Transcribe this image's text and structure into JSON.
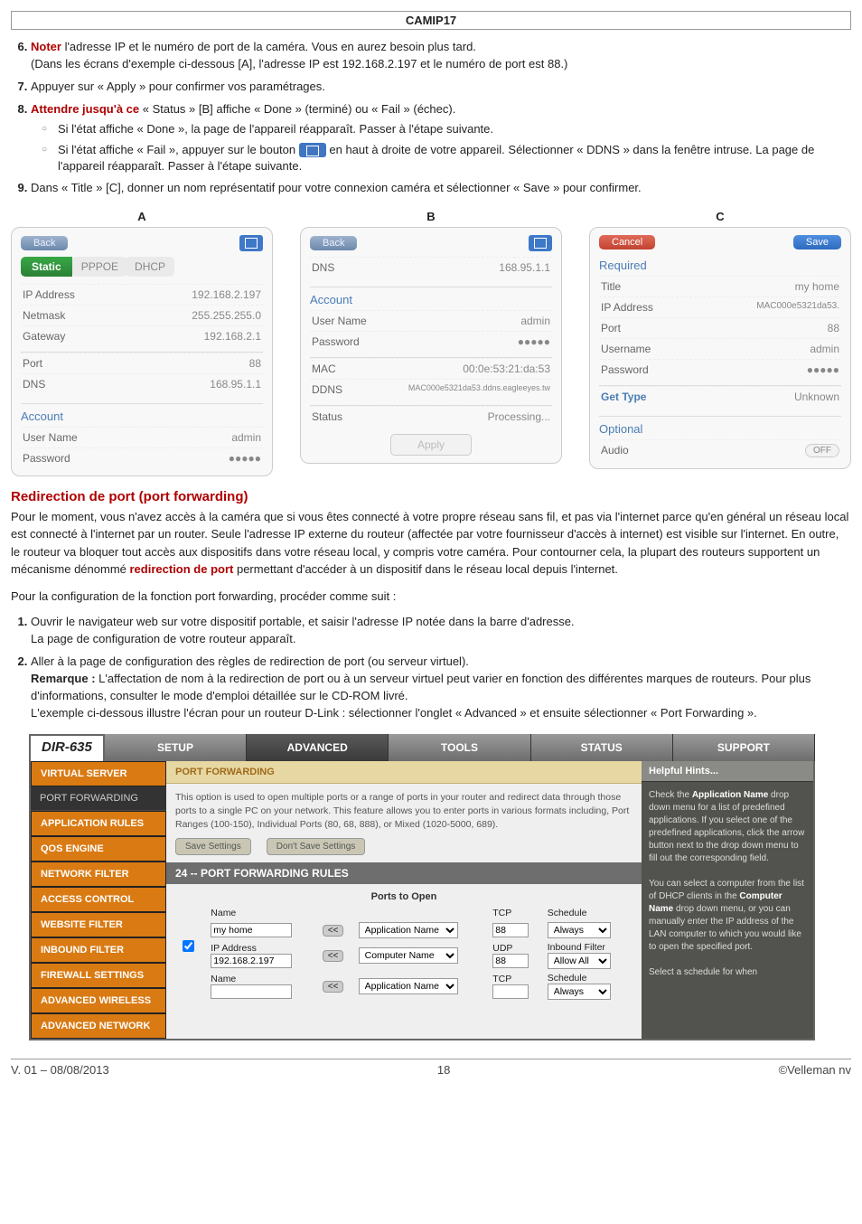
{
  "page_header": "CAMIP17",
  "step6": {
    "num": "6.",
    "lead": "Noter",
    "rest": " l'adresse IP et le numéro de port de la caméra. Vous en aurez besoin plus tard.",
    "sub": "(Dans les écrans d'exemple ci-dessous [A], l'adresse IP est 192.168.2.197 et le numéro de port est 88.)"
  },
  "step7": {
    "num": "7.",
    "text": "Appuyer sur « Apply » pour confirmer vos paramétrages."
  },
  "step8": {
    "num": "8.",
    "lead": "Attendre jusqu'à ce",
    "rest": " « Status » [B] affiche « Done » (terminé) ou « Fail » (échec).",
    "b1": "Si l'état affiche « Done », la page de l'appareil réapparaît. Passer à l'étape suivante.",
    "b2a": "Si l'état affiche « Fail », appuyer sur le bouton ",
    "b2b": " en haut à droite de votre appareil. Sélectionner « DDNS » dans la fenêtre intruse. La page de l'appareil réapparaît. Passer à l'étape suivante."
  },
  "step9": {
    "num": "9.",
    "text": "Dans « Title » [C], donner un nom représentatif pour votre connexion caméra et sélectionner « Save » pour confirmer."
  },
  "panelA": {
    "label": "A",
    "back": "Back",
    "static": "Static",
    "pppoe": "PPPOE",
    "dhcp": "DHCP",
    "ip_lbl": "IP Address",
    "ip_val": "192.168.2.197",
    "nm_lbl": "Netmask",
    "nm_val": "255.255.255.0",
    "gw_lbl": "Gateway",
    "gw_val": "192.168.2.1",
    "port_lbl": "Port",
    "port_val": "88",
    "dns_lbl": "DNS",
    "dns_val": "168.95.1.1",
    "account": "Account",
    "user_lbl": "User Name",
    "user_val": "admin",
    "pwd_lbl": "Password",
    "pwd_val": "●●●●●"
  },
  "panelB": {
    "label": "B",
    "back": "Back",
    "dns_lbl": "DNS",
    "dns_val": "168.95.1.1",
    "account": "Account",
    "user_lbl": "User Name",
    "user_val": "admin",
    "pwd_lbl": "Password",
    "pwd_val": "●●●●●",
    "mac_lbl": "MAC",
    "mac_val": "00:0e:53:21:da:53",
    "ddns_lbl": "DDNS",
    "ddns_val": "MAC000e5321da53.ddns.eagleeyes.tw",
    "status_lbl": "Status",
    "status_val": "Processing...",
    "apply": "Apply"
  },
  "panelC": {
    "label": "C",
    "cancel": "Cancel",
    "save": "Save",
    "required": "Required",
    "title_lbl": "Title",
    "title_val": "my home",
    "ip_lbl": "IP Address",
    "ip_val": "MAC000e5321da53.",
    "port_lbl": "Port",
    "port_val": "88",
    "user_lbl": "Username",
    "user_val": "admin",
    "pwd_lbl": "Password",
    "pwd_val": "●●●●●",
    "get_lbl": "Get Type",
    "get_val": "Unknown",
    "optional": "Optional",
    "audio_lbl": "Audio",
    "audio_val": "OFF"
  },
  "pf_title": "Redirection de port (port forwarding)",
  "pf_para1a": "Pour le moment, vous n'avez accès à la caméra que si vous êtes connecté à votre propre réseau sans fil, et pas via l'internet parce qu'en général un réseau local est connecté à l'internet par un router. Seule l'adresse IP externe du routeur (affectée par votre fournisseur d'accès à internet) est visible sur l'internet. En outre, le routeur va bloquer tout accès aux dispositifs dans votre réseau local, y compris votre caméra. Pour contourner cela, la plupart des routeurs supportent un mécanisme dénommé ",
  "pf_bold": "redirection de port",
  "pf_para1b": " permettant d'accéder à un dispositif dans le réseau local depuis l'internet.",
  "pf_para2": "Pour la configuration de la fonction port forwarding, procéder comme suit :",
  "pf_s1": {
    "num": "1.",
    "a": "Ouvrir le navigateur web sur votre dispositif portable, et saisir l'adresse IP notée dans la barre d'adresse.",
    "b": "La page de configuration de votre routeur apparaît."
  },
  "pf_s2": {
    "num": "2.",
    "a": "Aller à la page de configuration des règles de redirection de port (ou serveur virtuel).",
    "remark_lbl": "Remarque :",
    "remark": " L'affectation de nom à la redirection de port ou à un serveur virtuel peut varier en fonction des différentes marques de routeurs. Pour plus d'informations, consulter le mode d'emploi détaillée sur le CD-ROM livré.",
    "ex": "L'exemple ci-dessous illustre l'écran pour un routeur D-Link : sélectionner l'onglet « Advanced » et ensuite sélectionner « Port Forwarding »."
  },
  "dlink": {
    "model": "DIR-635",
    "tabs": {
      "setup": "SETUP",
      "advanced": "ADVANCED",
      "tools": "TOOLS",
      "status": "STATUS",
      "support": "SUPPORT"
    },
    "side": [
      "VIRTUAL SERVER",
      "PORT FORWARDING",
      "APPLICATION RULES",
      "QOS ENGINE",
      "NETWORK FILTER",
      "ACCESS CONTROL",
      "WEBSITE FILTER",
      "INBOUND FILTER",
      "FIREWALL SETTINGS",
      "ADVANCED WIRELESS",
      "ADVANCED NETWORK"
    ],
    "pf_head": "PORT FORWARDING",
    "pf_desc": "This option is used to open multiple ports or a range of ports in your router and redirect data through those ports to a single PC on your network. This feature allows you to enter ports in various formats including, Port Ranges (100-150), Individual Ports (80, 68, 888), or Mixed (1020-5000, 689).",
    "btn_save": "Save Settings",
    "btn_dont": "Don't Save Settings",
    "subhead": "24 -- PORT FORWARDING RULES",
    "ports_open": "Ports to Open",
    "col_name": "Name",
    "col_tcp": "TCP",
    "col_udp": "UDP",
    "col_sched": "Schedule",
    "col_inb": "Inbound Filter",
    "row1_name": "my home",
    "row1_app": "Application Name",
    "row1_port": "88",
    "row1_sched": "Always",
    "row2_ip": "IP Address",
    "row2_ipv": "192.168.2.197",
    "row2_comp": "Computer Name",
    "row2_port": "88",
    "row2_filter": "Allow All",
    "row3_name": "Name",
    "row3_app": "Application Name",
    "row3_sched": "Always",
    "help_head": "Helpful Hints...",
    "help_body": "Check the <b>Application Name</b> drop down menu for a list of predefined applications. If you select one of the predefined applications, click the arrow button next to the drop down menu to fill out the corresponding field.<br><br>You can select a computer from the list of DHCP clients in the <b>Computer Name</b> drop down menu, or you can manually enter the IP address of the LAN computer to which you would like to open the specified port.<br><br>Select a schedule for when"
  },
  "footer": {
    "left": "V. 01 – 08/08/2013",
    "mid": "18",
    "right": "©Velleman nv"
  }
}
